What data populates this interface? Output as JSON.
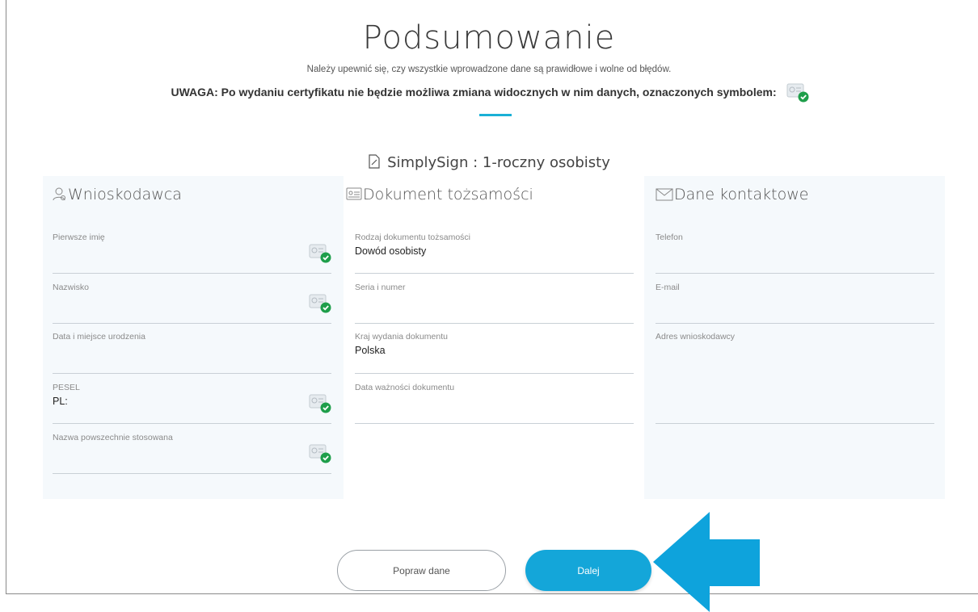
{
  "header": {
    "title": "Podsumowanie",
    "subtitle": "Należy upewnić się, czy wszystkie wprowadzone dane są prawidłowe i wolne od błędów.",
    "warning": "UWAGA: Po wydaniu certyfikatu nie będzie możliwa zmiana widocznych w nim danych, oznaczonych symbolem:"
  },
  "product": {
    "label": "SimplySign : 1-roczny osobisty"
  },
  "applicant": {
    "title": "Wnioskodawca",
    "fields": [
      {
        "label": "Pierwsze imię",
        "value": ""
      },
      {
        "label": "Nazwisko",
        "value": ""
      },
      {
        "label": "Data i miejsce urodzenia",
        "value": ""
      },
      {
        "label": "PESEL",
        "value": "PL:"
      },
      {
        "label": "Nazwa powszechnie stosowana",
        "value": ""
      }
    ]
  },
  "document": {
    "title": "Dokument tożsamości",
    "fields": [
      {
        "label": "Rodzaj dokumentu tożsamości",
        "value": "Dowód osobisty"
      },
      {
        "label": "Seria i numer",
        "value": ""
      },
      {
        "label": "Kraj wydania dokumentu",
        "value": "Polska"
      },
      {
        "label": "Data ważności dokumentu",
        "value": ""
      }
    ]
  },
  "contact": {
    "title": "Dane kontaktowe",
    "fields": [
      {
        "label": "Telefon",
        "value": ""
      },
      {
        "label": "E-mail",
        "value": ""
      },
      {
        "label": "Adres wnioskodawcy",
        "value": ""
      }
    ]
  },
  "actions": {
    "back_label": "Popraw dane",
    "next_label": "Dalej"
  },
  "colors": {
    "accent": "#14a6d9",
    "arrow": "#0ea3dc",
    "check": "#1e9e4a"
  },
  "icons": {
    "certificate_badge": "certificate-check-icon",
    "product": "document-pen-icon",
    "applicant": "user-icon",
    "document": "id-card-icon",
    "contact": "envelope-icon",
    "pointer": "arrow-left-icon"
  }
}
